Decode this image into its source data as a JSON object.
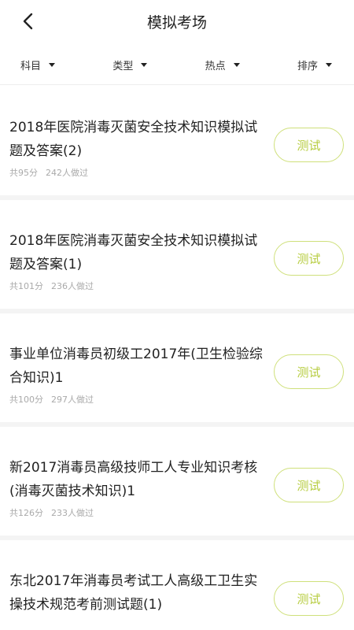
{
  "header": {
    "title": "模拟考场"
  },
  "filters": [
    "科目",
    "类型",
    "热点",
    "排序"
  ],
  "items": [
    {
      "title": "2018年医院消毒灭菌安全技术知识模拟试题及答案(2)",
      "score": "共95分",
      "done": "242人做过",
      "action": "测试"
    },
    {
      "title": "2018年医院消毒灭菌安全技术知识模拟试题及答案(1)",
      "score": "共101分",
      "done": "236人做过",
      "action": "测试"
    },
    {
      "title": "事业单位消毒员初级工2017年(卫生检验综合知识)1",
      "score": "共100分",
      "done": "297人做过",
      "action": "测试"
    },
    {
      "title": "新2017消毒员高级技师工人专业知识考核(消毒灭菌技术知识)1",
      "score": "共126分",
      "done": "233人做过",
      "action": "测试"
    },
    {
      "title": "东北2017年消毒员考试工人高级工卫生实操技术规范考前测试题(1)",
      "score": "",
      "done": "",
      "action": "测试"
    }
  ]
}
